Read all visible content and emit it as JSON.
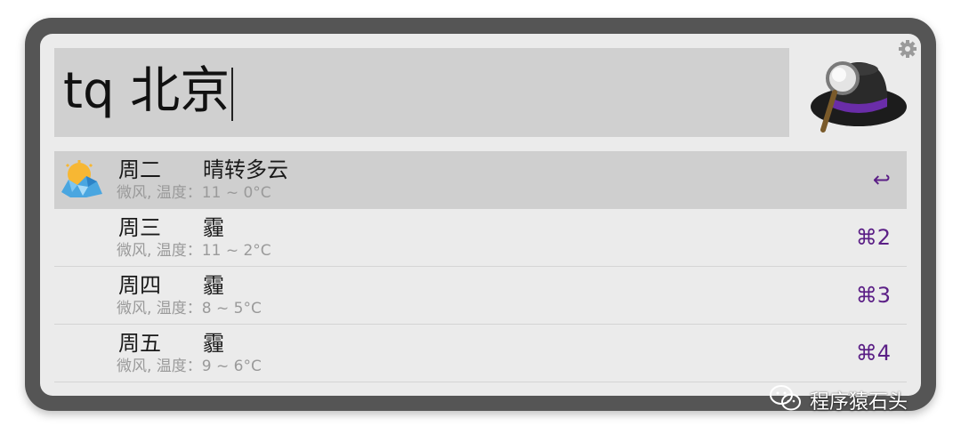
{
  "search": {
    "query": "tq 北京"
  },
  "icons": {
    "settings": "gear-icon",
    "app_logo": "alfred-hat-logo",
    "weather": "partly-cloudy-weather-icon",
    "return": "return-key-icon"
  },
  "colors": {
    "shortcut": "#5b1f86",
    "selected_row": "#cfcfcf",
    "frame": "#555555"
  },
  "results": [
    {
      "day": "周二",
      "condition": "晴转多云",
      "detail": "微风, 温度：11 ~ 0°C",
      "shortcut": "↩",
      "selected": true
    },
    {
      "day": "周三",
      "condition": "霾",
      "detail": "微风, 温度：11 ~ 2°C",
      "shortcut": "⌘2",
      "selected": false
    },
    {
      "day": "周四",
      "condition": "霾",
      "detail": "微风, 温度：8 ~ 5°C",
      "shortcut": "⌘3",
      "selected": false
    },
    {
      "day": "周五",
      "condition": "霾",
      "detail": "微风, 温度：9 ~ 6°C",
      "shortcut": "⌘4",
      "selected": false
    }
  ],
  "watermark": {
    "text": "程序猿石头",
    "icon": "wechat-icon"
  }
}
